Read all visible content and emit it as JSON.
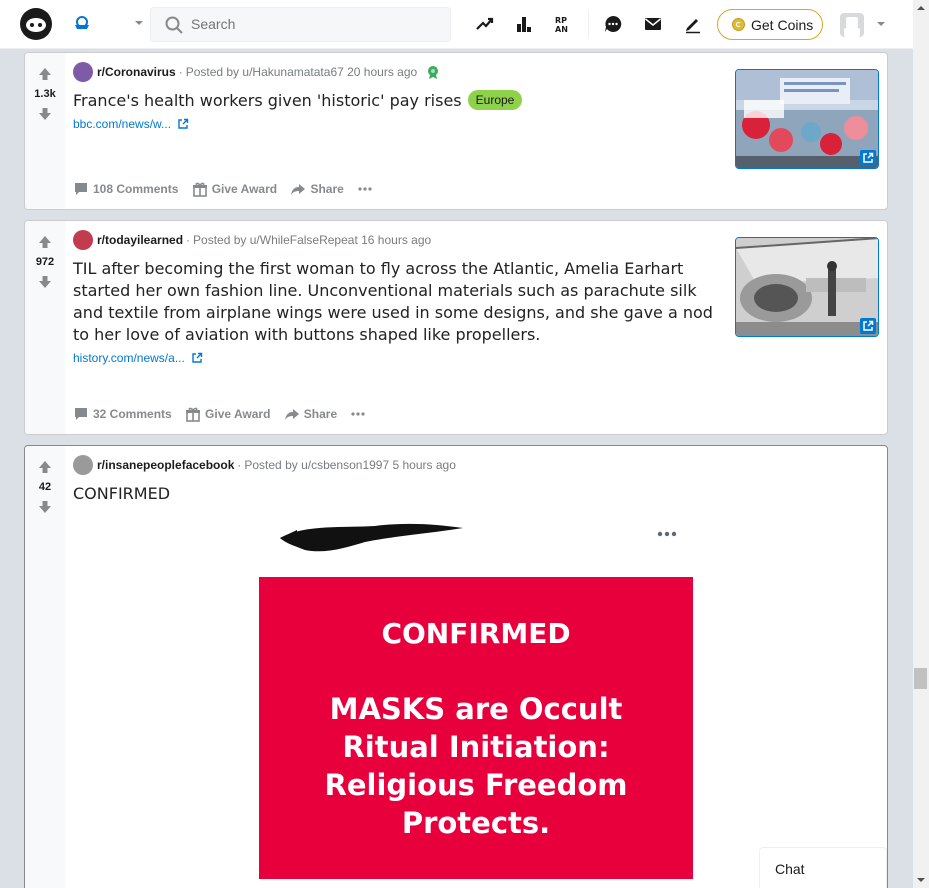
{
  "header": {
    "search_placeholder": "Search",
    "get_coins": "Get Coins",
    "icons": [
      "reddit-logo",
      "home-icon",
      "popular-icon",
      "leaderboard-icon",
      "rpan-icon",
      "chat-icon",
      "mail-icon",
      "create-post-icon",
      "coin-icon",
      "avatar"
    ]
  },
  "posts": [
    {
      "subreddit": "r/Coronavirus",
      "posted_by": "Posted by u/Hakunamatata67 20 hours ago",
      "votes": "1.3k",
      "title": "France's health workers given 'historic' pay rises",
      "flair": "Europe",
      "link": "bbc.com/news/w...",
      "comments": "108 Comments",
      "award": "Give Award",
      "share": "Share",
      "thumbnail": "protest-photo"
    },
    {
      "subreddit": "r/todayilearned",
      "posted_by": "Posted by u/WhileFalseRepeat 16 hours ago",
      "votes": "972",
      "title": "TIL after becoming the first woman to fly across the Atlantic, Amelia Earhart started her own fashion line. Unconventional materials such as parachute silk and textile from airplane wings were used in some designs, and she gave a nod to her love of aviation with buttons shaped like propellers.",
      "link": "history.com/news/a...",
      "comments": "32 Comments",
      "award": "Give Award",
      "share": "Share",
      "thumbnail": "airplane-photo"
    },
    {
      "subreddit": "r/insanepeoplefacebook",
      "posted_by": "Posted by u/csbenson1997 5 hours ago",
      "votes": "42",
      "title": "CONFIRMED",
      "image_lines": [
        "CONFIRMED",
        "MASKS are Occult",
        "Ritual Initiation:",
        "Religious Freedom",
        "Protects."
      ]
    }
  ],
  "chat": {
    "label": "Chat"
  },
  "colors": {
    "accent": "#0079d3",
    "flair": "#8ed14b",
    "card": "#e8003d",
    "coins_border": "#d9a52b"
  }
}
